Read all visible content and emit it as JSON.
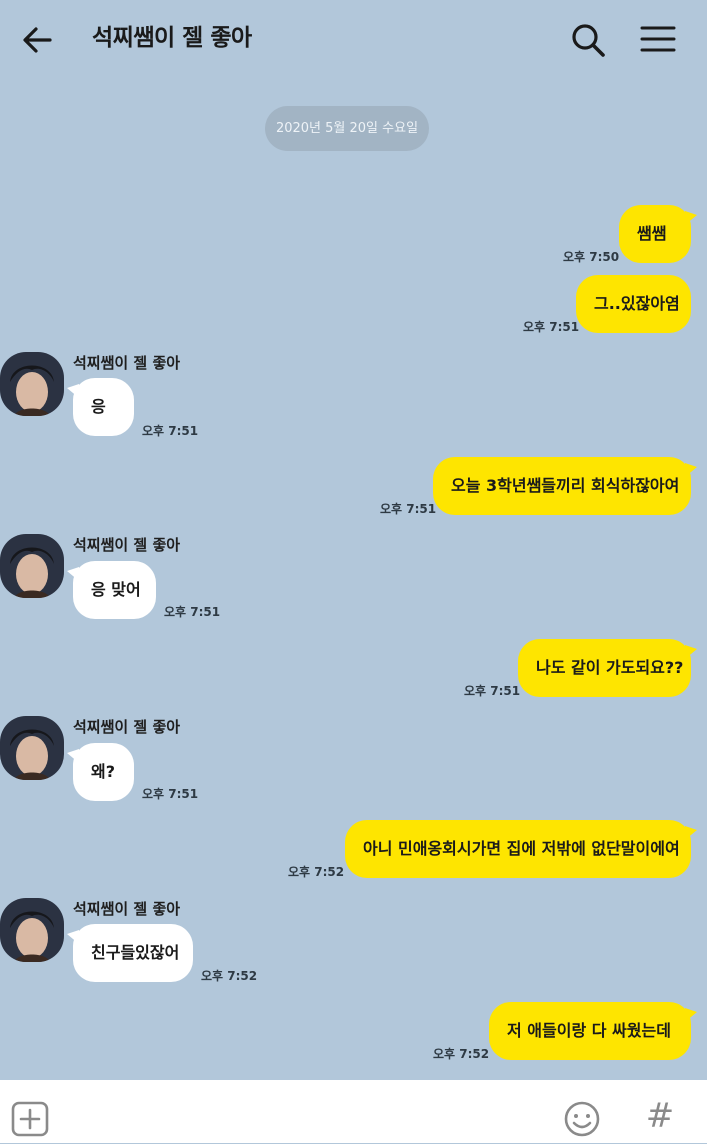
{
  "header": {
    "title": "석찌쌤이 젤 좋아",
    "back_icon": "arrow-left-icon",
    "search_icon": "search-icon",
    "menu_icon": "hamburger-menu-icon"
  },
  "date_divider": "2020년 5월 20일 수요일",
  "sender_name": "석찌쌤이 젤 좋아",
  "messages": [
    {
      "from": "me",
      "text": "쌤쌤",
      "time": "오후 7:50"
    },
    {
      "from": "me",
      "text": "그..있잖아염",
      "time": "오후 7:51"
    },
    {
      "from": "other",
      "text": "응",
      "time": "오후 7:51"
    },
    {
      "from": "me",
      "text": "오늘 3학년쌤들끼리 회식하잖아여",
      "time": "오후 7:51"
    },
    {
      "from": "other",
      "text": "응 맞어",
      "time": "오후 7:51"
    },
    {
      "from": "me",
      "text": "나도 같이 가도되요??",
      "time": "오후 7:51"
    },
    {
      "from": "other",
      "text": "왜?",
      "time": "오후 7:51"
    },
    {
      "from": "me",
      "text": "아니 민애옹회시가면 집에 저밖에 없단말이에여",
      "time": "오후 7:52"
    },
    {
      "from": "other",
      "text": "친구들있잖어",
      "time": "오후 7:52"
    },
    {
      "from": "me",
      "text": "저 애들이랑 다 싸웠는데",
      "time": "오후 7:52"
    }
  ],
  "input_bar": {
    "plus_icon": "plus-square-icon",
    "emoji_icon": "smiley-icon",
    "hash_label": "#"
  },
  "colors": {
    "background": "#b2c7da",
    "my_bubble": "#fee500",
    "other_bubble": "#ffffff"
  }
}
